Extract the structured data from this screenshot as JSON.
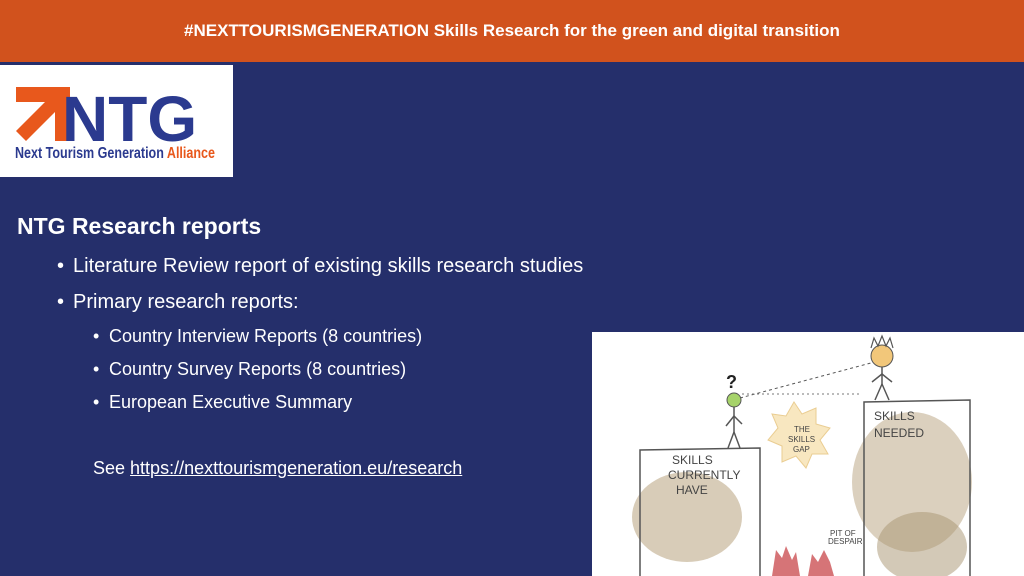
{
  "header": {
    "title": "#NEXTTOURISMGENERATION Skills Research for the green and digital transition"
  },
  "logo": {
    "mark": "NTG",
    "tagline_a": "Next Tourism Generation",
    "tagline_b": "Alliance"
  },
  "content": {
    "heading": "NTG Research reports",
    "bullets": [
      "Literature Review report of existing skills research studies",
      "Primary research reports:"
    ],
    "sub_bullets": [
      "Country Interview Reports (8 countries)",
      "Country Survey Reports (8 countries)",
      "European Executive Summary"
    ],
    "see_prefix": "See",
    "link": "https://nexttourismgeneration.eu/research"
  },
  "illustration": {
    "label_have": [
      "SKILLS",
      "CURRENTLY",
      "HAVE"
    ],
    "label_needed": [
      "SKILLS",
      "NEEDED"
    ],
    "label_gap": [
      "THE",
      "SKILLS",
      "GAP"
    ],
    "label_pit": [
      "PIT OF",
      "DESPAIR"
    ],
    "question_mark": "?"
  },
  "colors": {
    "header": "#d1521d",
    "background": "#252f6b",
    "logo_blue": "#2b3a8f",
    "logo_orange": "#e8581c"
  }
}
